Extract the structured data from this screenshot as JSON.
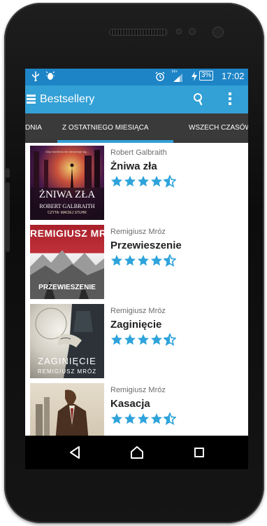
{
  "status_bar": {
    "left_icons": [
      "usb-icon",
      "android-debug-icon"
    ],
    "right_icons": [
      "alarm-icon",
      "signal-icon",
      "charging-icon"
    ],
    "battery": "3%",
    "time": "17:02",
    "signal_badge": "H+"
  },
  "action_bar": {
    "title": "Bestsellery",
    "icons": [
      "menu-icon",
      "search-icon",
      "overflow-menu-icon"
    ]
  },
  "tabs": [
    {
      "label": "DNIA",
      "selected": false
    },
    {
      "label": "Z OSTATNIEGO MIESIĄCA",
      "selected": true
    },
    {
      "label": "WSZECH CZASÓW",
      "selected": false
    }
  ],
  "books": [
    {
      "author": "Robert Galbraith",
      "title": "Żniwa zła",
      "rating": 4.5,
      "cover": {
        "tagline": "Gdy morderca nie zatrzymuje się...",
        "title": "ŻNIWA ZŁA",
        "author": "ROBERT GALBRAITH",
        "narrator": "CZYTA: MACIEJ STUHR"
      }
    },
    {
      "author": "Remigiusz Mróz",
      "title": "Przewieszenie",
      "rating": 4.5,
      "cover": {
        "author": "REMIGIUSZ MRÓZ",
        "title": "PRZEWIESZENIE"
      }
    },
    {
      "author": "Remigiusz Mróz",
      "title": "Zaginięcie",
      "rating": 4.5,
      "cover": {
        "title": "ZAGINIĘCIE",
        "author": "REMIGIUSZ MRÓZ"
      }
    },
    {
      "author": "Remigiusz Mróz",
      "title": "Kasacja",
      "rating": 4.5,
      "cover": {}
    }
  ],
  "nav_bar": {
    "icons": [
      "back-icon",
      "home-icon",
      "recents-icon"
    ]
  },
  "colors": {
    "status_bar": "#1d84c6",
    "action_bar": "#33a0d6",
    "tab_bar": "#3a3a3a",
    "tab_indicator": "#33a0d6",
    "star": "#2ea3db"
  }
}
